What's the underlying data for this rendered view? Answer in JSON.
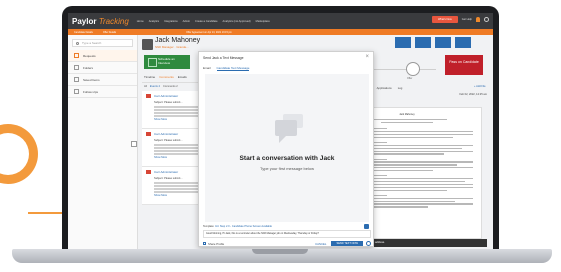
{
  "app": {
    "logo_main": "Paylor",
    "logo_sub": "Tracking",
    "nav": [
      "Home",
      "Analytics",
      "Integrations",
      "Admin",
      "Create a Candidate",
      "Analytics (not Approved)",
      "Marketplace"
    ],
    "whats_new": "What's New",
    "get_help": "Get Help"
  },
  "subbar": {
    "left": "Candidate Details",
    "mid": "Offer Details",
    "right": "Offer Agreement on Apr 13, 2021 13:15 pm"
  },
  "sidebar": {
    "search_placeholder": "Type a Search",
    "items": [
      "Requests",
      "Folders",
      "Saved Items",
      "Follow-Ups"
    ]
  },
  "candidate": {
    "name": "Jack Mahoney",
    "job": "Shift Manager · Grande..."
  },
  "schedule_button": "Schedule an Interview",
  "left_tabs": [
    "Timeline",
    "Comments",
    "Emails"
  ],
  "left_filter": [
    "All",
    "Events 4",
    "Comments 2"
  ],
  "emails": [
    {
      "from": "Carr Administrator",
      "subject": "Subject: Please submit...",
      "more": "Show More"
    },
    {
      "from": "Carr Administrator",
      "subject": "Subject: Please submit...",
      "more": "Show More"
    },
    {
      "from": "Carr Administrator",
      "subject": "Subject: Please submit...",
      "more": "Show More"
    }
  ],
  "right_panel": {
    "pipeline_labels": [
      "Reviewed",
      "Interview",
      "Offer"
    ],
    "pass_on": "Pass on Candidate",
    "doc_tabs": [
      "Resumes",
      "Profile",
      "Attributes",
      "Applications",
      "Log"
    ],
    "add_file": "+ Add File",
    "doc_name": "Sample Resume.pdf",
    "doc_date": "Feb 02, 2022, 12:25 am",
    "doc_heading": "Jack Mahoney",
    "footer_note": "There is 1 other record with this email address."
  },
  "modal": {
    "title": "Send Jack a Text Message",
    "tabs": [
      "Email",
      "Candidate Text Message"
    ],
    "empty_title": "Start a conversation with Jack",
    "empty_sub": "Type your first message below",
    "template_label": "Template:",
    "template_value": "Intl. Step 2.0 - Candidate Phone Screen Available",
    "message_value": "Good Morning, Hi Jack, this is a reminder about the Shift Manager job on Wednesday, Thursday or Friday?",
    "share_profile": "Share Profile",
    "cancel": "CANCEL",
    "send": "SEND TEXT NOW"
  }
}
